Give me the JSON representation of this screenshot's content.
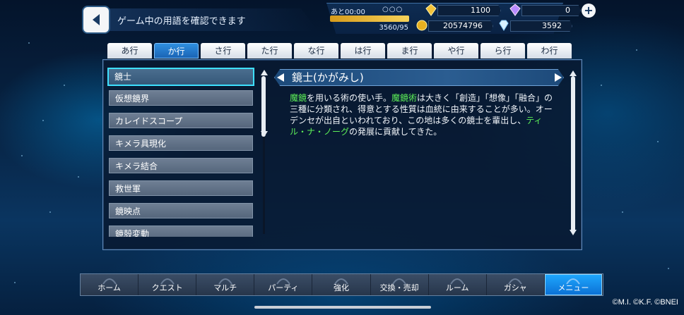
{
  "header": {
    "title": "ゲーム中の用語を確認できます"
  },
  "status": {
    "stamina_label": "あと00:00",
    "stamina_dots": "○○○",
    "stamina_value": "3560/95",
    "stamina_fraction": 1.0,
    "gold_gem": "1100",
    "rainbow_gem": "0",
    "coins": "20574796",
    "diamonds": "3592"
  },
  "tabs": [
    "あ行",
    "か行",
    "さ行",
    "た行",
    "な行",
    "は行",
    "ま行",
    "や行",
    "ら行",
    "わ行"
  ],
  "active_tab": 1,
  "terms": [
    "鏡士",
    "仮想鏡界",
    "カレイドスコープ",
    "キメラ具現化",
    "キメラ結合",
    "救世軍",
    "鏡映点",
    "鏡殻変動"
  ],
  "detail": {
    "title": "鏡士(かがみし)",
    "body_segments": [
      {
        "text": "魔鏡",
        "hl": true
      },
      {
        "text": "を用いる術の使い手。",
        "hl": false
      },
      {
        "text": "魔鏡術",
        "hl": true
      },
      {
        "text": "は大きく「創造」「想像」「融合」の三種に分類され、得意とする性質は血統に由来することが多い。オーデンセが出自といわれており、この地は多くの鏡士を輩出し、",
        "hl": false
      },
      {
        "text": "ティル・ナ・ノーグ",
        "hl": true
      },
      {
        "text": "の発展に貢献してきた。",
        "hl": false
      }
    ]
  },
  "nav": [
    "ホーム",
    "クエスト",
    "マルチ",
    "パーティ",
    "強化",
    "交換・売却",
    "ルーム",
    "ガシャ",
    "メニュー"
  ],
  "active_nav": 8,
  "copyright": "©M.I. ©K.F. ©BNEI",
  "colors": {
    "highlight": "#5df058",
    "active_tab": "#2f8fe0",
    "selected_border": "#3ee0ff",
    "active_nav": "#1fa9ff"
  }
}
